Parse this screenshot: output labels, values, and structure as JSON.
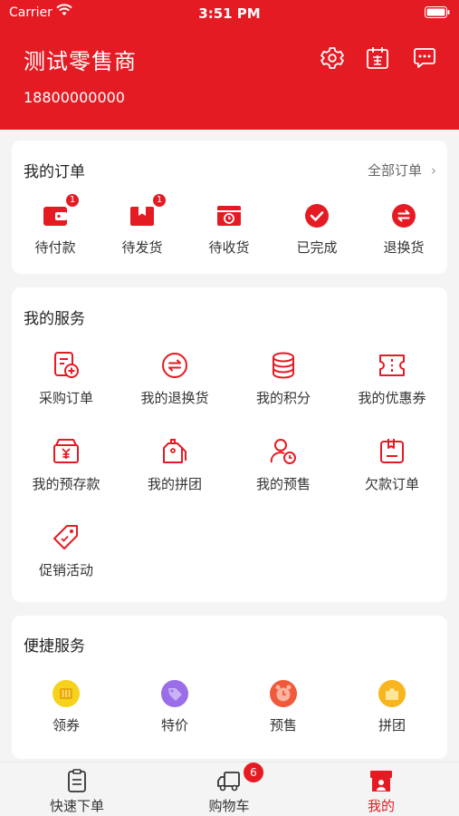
{
  "status_bar": {
    "carrier": "Carrier",
    "time": "3:51 PM"
  },
  "header": {
    "shop_name": "测试零售商",
    "phone": "18800000000"
  },
  "orders": {
    "title": "我的订单",
    "all_label": "全部订单",
    "items": [
      {
        "label": "待付款",
        "icon": "wallet-icon",
        "badge": "1"
      },
      {
        "label": "待发货",
        "icon": "package-icon",
        "badge": "1"
      },
      {
        "label": "待收货",
        "icon": "delivery-box-icon",
        "badge": ""
      },
      {
        "label": "已完成",
        "icon": "check-circle-icon",
        "badge": ""
      },
      {
        "label": "退换货",
        "icon": "exchange-icon",
        "badge": ""
      }
    ]
  },
  "services": {
    "title": "我的服务",
    "items": [
      {
        "label": "采购订单",
        "icon": "purchase-order-icon"
      },
      {
        "label": "我的退换货",
        "icon": "return-exchange-icon"
      },
      {
        "label": "我的积分",
        "icon": "points-icon"
      },
      {
        "label": "我的优惠券",
        "icon": "coupon-icon"
      },
      {
        "label": "我的预存款",
        "icon": "deposit-icon"
      },
      {
        "label": "我的拼团",
        "icon": "group-buy-icon"
      },
      {
        "label": "我的预售",
        "icon": "presale-icon"
      },
      {
        "label": "欠款订单",
        "icon": "debt-order-icon"
      },
      {
        "label": "促销活动",
        "icon": "promotion-tag-icon"
      }
    ]
  },
  "quick": {
    "title": "便捷服务",
    "items": [
      {
        "label": "领券",
        "icon": "coupon-yellow-icon"
      },
      {
        "label": "特价",
        "icon": "special-price-icon"
      },
      {
        "label": "预售",
        "icon": "presale-alarm-icon"
      },
      {
        "label": "拼团",
        "icon": "group-puzzle-icon"
      }
    ]
  },
  "tabbar": {
    "items": [
      {
        "label": "快速下单",
        "icon": "clipboard-icon"
      },
      {
        "label": "购物车",
        "icon": "truck-icon",
        "badge": "6"
      },
      {
        "label": "我的",
        "icon": "store-profile-icon"
      }
    ],
    "active": "我的"
  },
  "colors": {
    "primary": "#e51b24",
    "background": "#f4f4f4",
    "card": "#ffffff"
  }
}
